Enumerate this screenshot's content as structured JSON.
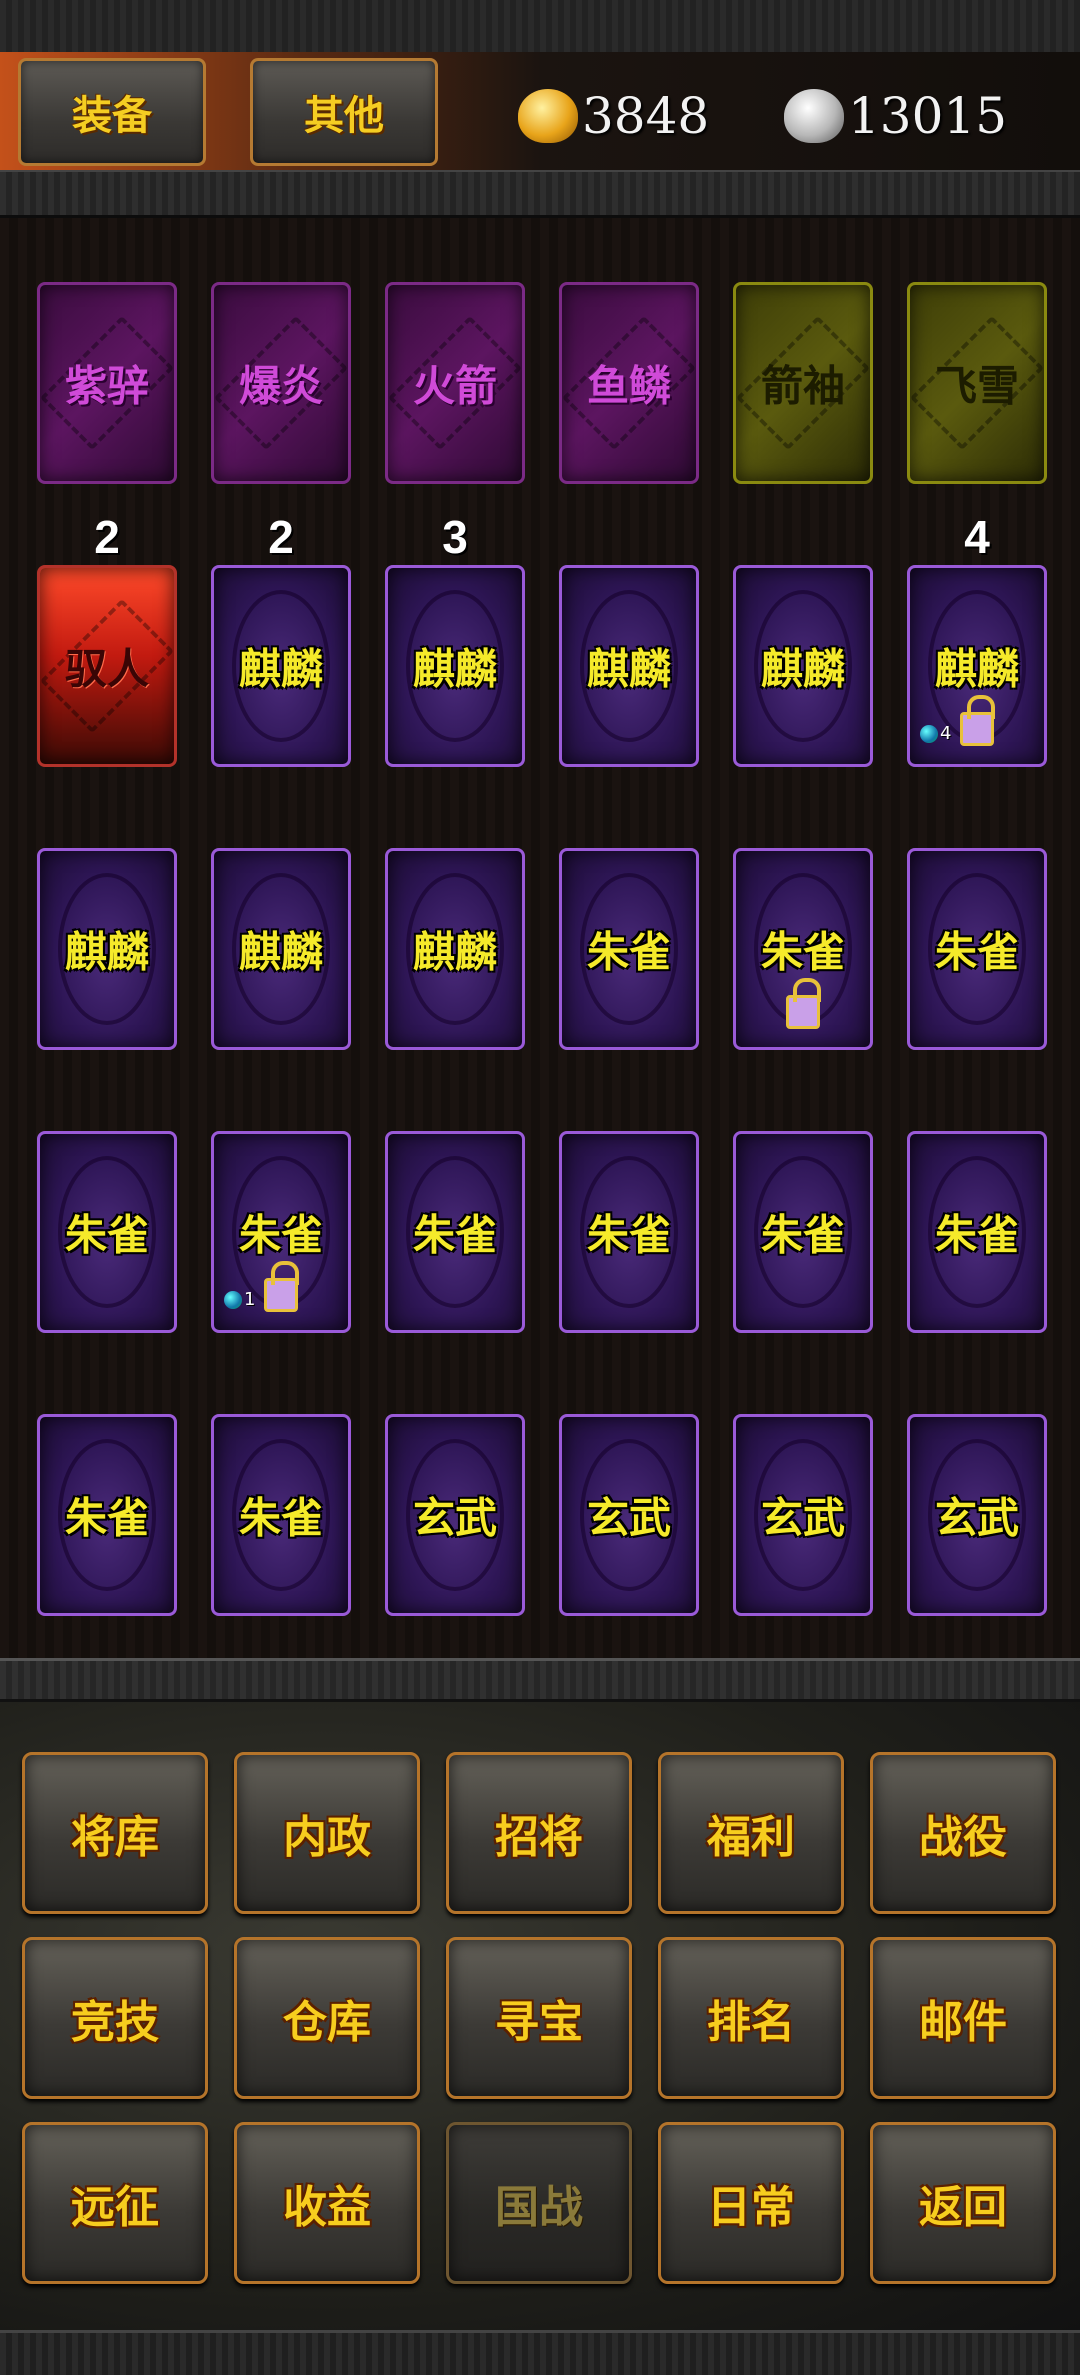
{
  "tabs": {
    "equip": "装备",
    "other": "其他"
  },
  "currency": {
    "gold": "3848",
    "silver": "13015"
  },
  "cards": [
    {
      "name": "紫骍",
      "style": "magenta",
      "count": "2"
    },
    {
      "name": "爆炎",
      "style": "magenta",
      "count": "2"
    },
    {
      "name": "火箭",
      "style": "magenta",
      "count": "3"
    },
    {
      "name": "鱼鳞",
      "style": "magenta",
      "count": ""
    },
    {
      "name": "箭袖",
      "style": "olive",
      "count": ""
    },
    {
      "name": "飞雪",
      "style": "olive",
      "count": "4"
    },
    {
      "name": "驭人",
      "style": "red"
    },
    {
      "name": "麒麟",
      "style": "purple"
    },
    {
      "name": "麒麟",
      "style": "purple"
    },
    {
      "name": "麒麟",
      "style": "purple"
    },
    {
      "name": "麒麟",
      "style": "purple"
    },
    {
      "name": "麒麟",
      "style": "purple",
      "locked": true,
      "badge": "4"
    },
    {
      "name": "麒麟",
      "style": "purple"
    },
    {
      "name": "麒麟",
      "style": "purple"
    },
    {
      "name": "麒麟",
      "style": "purple"
    },
    {
      "name": "朱雀",
      "style": "purple"
    },
    {
      "name": "朱雀",
      "style": "purple",
      "locked": true
    },
    {
      "name": "朱雀",
      "style": "purple"
    },
    {
      "name": "朱雀",
      "style": "purple"
    },
    {
      "name": "朱雀",
      "style": "purple",
      "locked": true,
      "badge": "1"
    },
    {
      "name": "朱雀",
      "style": "purple"
    },
    {
      "name": "朱雀",
      "style": "purple"
    },
    {
      "name": "朱雀",
      "style": "purple"
    },
    {
      "name": "朱雀",
      "style": "purple"
    },
    {
      "name": "朱雀",
      "style": "purple"
    },
    {
      "name": "朱雀",
      "style": "purple"
    },
    {
      "name": "玄武",
      "style": "purple"
    },
    {
      "name": "玄武",
      "style": "purple"
    },
    {
      "name": "玄武",
      "style": "purple"
    },
    {
      "name": "玄武",
      "style": "purple"
    }
  ],
  "menu": [
    {
      "label": "将库"
    },
    {
      "label": "内政"
    },
    {
      "label": "招将"
    },
    {
      "label": "福利"
    },
    {
      "label": "战役"
    },
    {
      "label": "竞技"
    },
    {
      "label": "仓库"
    },
    {
      "label": "寻宝"
    },
    {
      "label": "排名"
    },
    {
      "label": "邮件"
    },
    {
      "label": "远征"
    },
    {
      "label": "收益"
    },
    {
      "label": "国战",
      "disabled": true
    },
    {
      "label": "日常"
    },
    {
      "label": "返回"
    }
  ]
}
